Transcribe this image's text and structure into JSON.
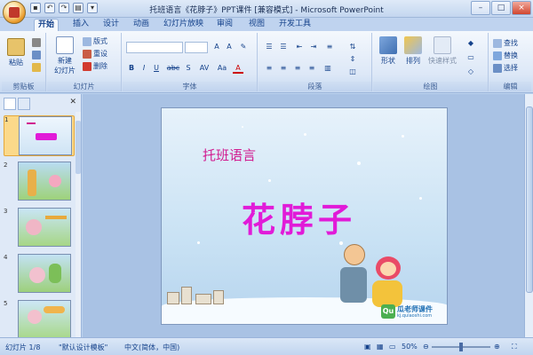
{
  "window": {
    "title": "托班语言《花脖子》PPT课件 [兼容模式] - Microsoft PowerPoint",
    "controls": [
      "–",
      "□",
      "×"
    ]
  },
  "tabs": [
    {
      "label": "开始",
      "active": true
    },
    {
      "label": "插入"
    },
    {
      "label": "设计"
    },
    {
      "label": "动画"
    },
    {
      "label": "幻灯片放映"
    },
    {
      "label": "审阅"
    },
    {
      "label": "视图"
    },
    {
      "label": "开发工具"
    }
  ],
  "ribbon": {
    "clipboard": {
      "label": "剪贴板",
      "paste": "粘贴"
    },
    "slides": {
      "label": "幻灯片",
      "new_slide_line1": "新建",
      "new_slide_line2": "幻灯片",
      "layout": "版式",
      "reset": "重设",
      "delete": "删除"
    },
    "font": {
      "label": "字体",
      "bold": "B",
      "italic": "I",
      "underline": "U",
      "strike": "abc",
      "shadow": "S",
      "spacing": "AV",
      "case": "Aa",
      "color": "A"
    },
    "paragraph": {
      "label": "段落"
    },
    "drawing": {
      "label": "绘图",
      "shapes": "形状",
      "arrange": "排列",
      "quick_styles": "快速样式"
    },
    "editing": {
      "label": "编辑",
      "find": "查找",
      "replace": "替换",
      "select": "选择"
    }
  },
  "thumbnails": {
    "numbers": [
      "1",
      "2",
      "3",
      "4",
      "5"
    ],
    "selected": 0
  },
  "slide": {
    "subtitle": "托班语言",
    "title": "花脖子",
    "logo_text": "瓜老师课件",
    "logo_url": "kj.qulaoshi.com"
  },
  "statusbar": {
    "slide_info": "幻灯片 1/8",
    "theme": "\"默认设计模板\"",
    "language": "中文(简体，中国)",
    "zoom": "50%",
    "zoom_level": 0.5
  }
}
